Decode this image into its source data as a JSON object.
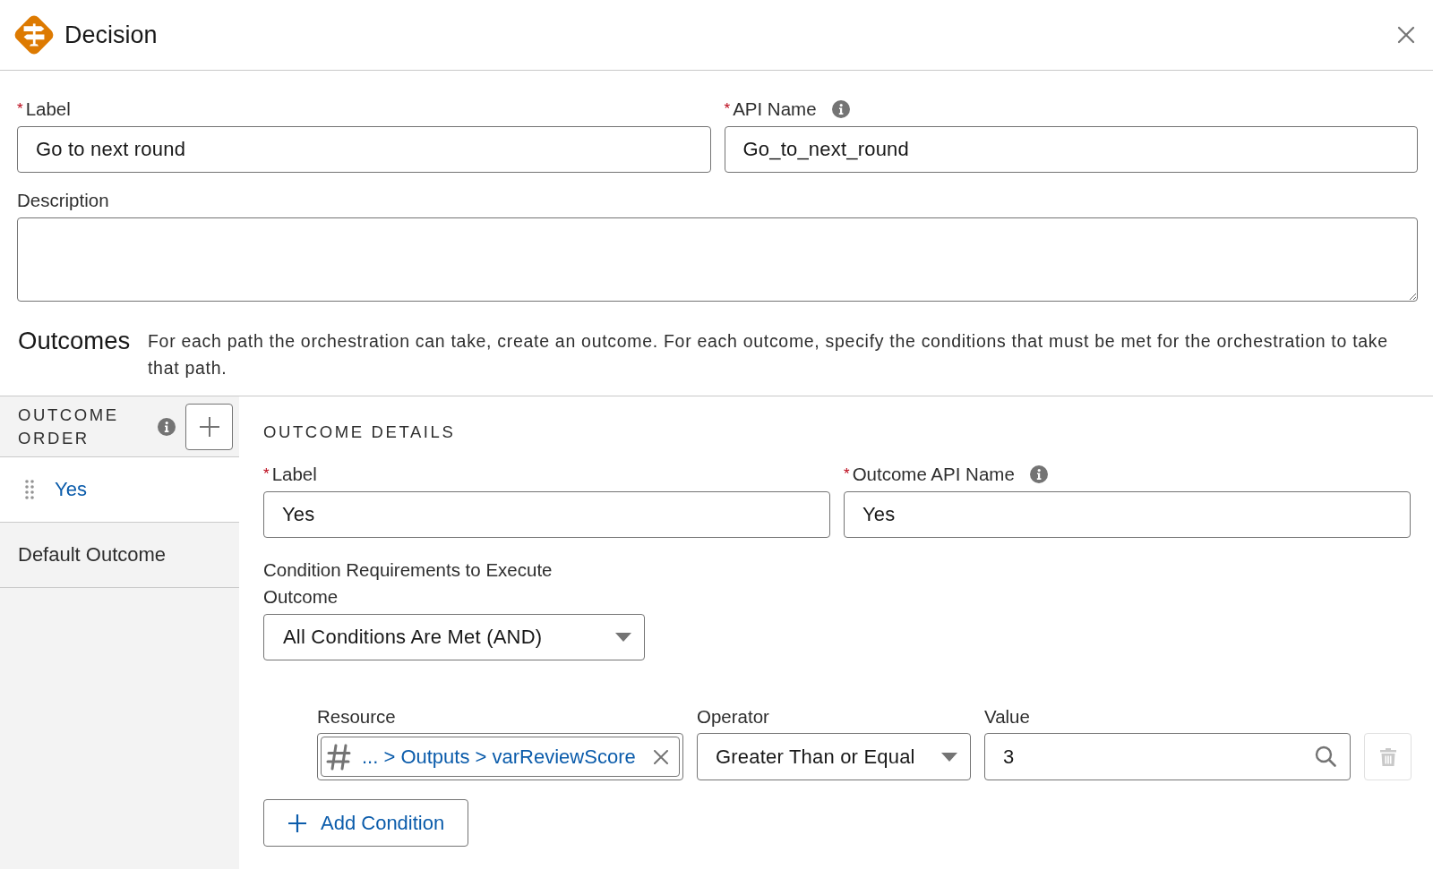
{
  "header": {
    "title": "Decision"
  },
  "fields": [
    {
      "label": "Label",
      "required_mark": "*",
      "info": false,
      "value": "Go to next round"
    },
    {
      "label": "API Name",
      "required_mark": "*",
      "info": true,
      "value": "Go_to_next_round"
    }
  ],
  "description": {
    "label": "Description"
  },
  "outcomes": {
    "title": "Outcomes",
    "text": "For each path the orchestration can take, create an outcome. For each outcome, specify the conditions that must be met for the orchestration to take that path."
  },
  "outcome_order": {
    "heading": "OUTCOME ORDER",
    "items": [
      {
        "label": "Yes",
        "selected": true,
        "draggable": true
      },
      {
        "label": "Default Outcome",
        "selected": false,
        "draggable": false
      }
    ]
  },
  "outcome_details": {
    "heading": "OUTCOME DETAILS",
    "fields": [
      {
        "label": "Label",
        "required_mark": "*",
        "info": false,
        "value": "Yes"
      },
      {
        "label": "Outcome API Name",
        "required_mark": "*",
        "info": true,
        "value": "Yes"
      }
    ],
    "requirement": {
      "label": "Condition Requirements to Execute Outcome",
      "value": "All Conditions Are Met (AND)"
    },
    "condition_columns": [
      "Resource",
      "Operator",
      "Value"
    ],
    "conditions": [
      {
        "resource": "... > Outputs > varReviewScore",
        "operator": "Greater Than or Equal",
        "value": "3",
        "delete_disabled": true
      }
    ],
    "add_button": "Add Condition"
  }
}
